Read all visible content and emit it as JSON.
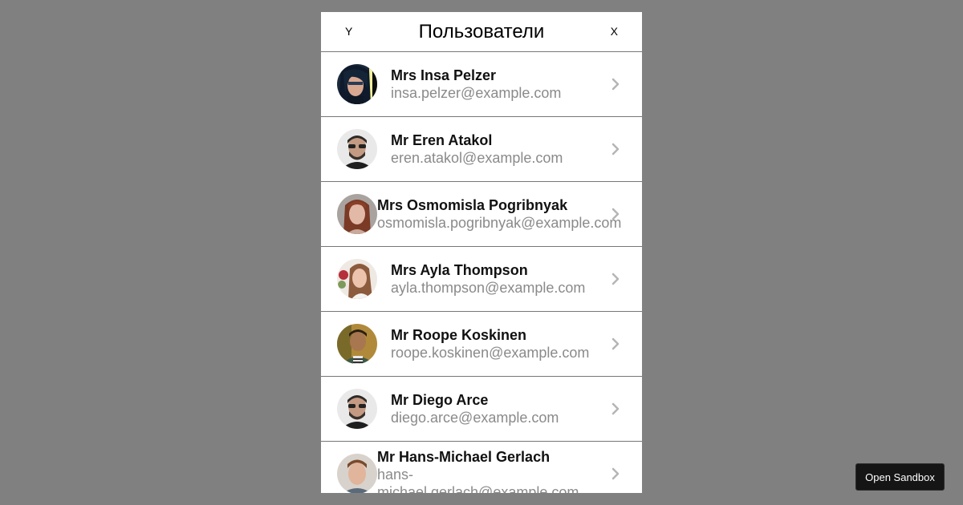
{
  "header": {
    "left_label": "Y",
    "title": "Пользователи",
    "right_label": "X"
  },
  "users": [
    {
      "name": "Mrs Insa Pelzer",
      "email": "insa.pelzer@example.com"
    },
    {
      "name": "Mr Eren Atakol",
      "email": "eren.atakol@example.com"
    },
    {
      "name": "Mrs Osmomisla Pogribnyak",
      "email": "osmomisla.pogribnyak@example.com"
    },
    {
      "name": "Mrs Ayla Thompson",
      "email": "ayla.thompson@example.com"
    },
    {
      "name": "Mr Roope Koskinen",
      "email": "roope.koskinen@example.com"
    },
    {
      "name": "Mr Diego Arce",
      "email": "diego.arce@example.com"
    },
    {
      "name": "Mr Hans-Michael Gerlach",
      "email": "hans-michael.gerlach@example.com"
    }
  ],
  "row_icon": "chevron-right-icon",
  "sandbox_button": {
    "label": "Open Sandbox"
  },
  "colors": {
    "backdrop": "#808080",
    "panel": "#ffffff",
    "divider": "#777777",
    "email_text": "#8a8a8a",
    "chevron": "#b5b5b5",
    "sandbox_bg": "#151515"
  }
}
